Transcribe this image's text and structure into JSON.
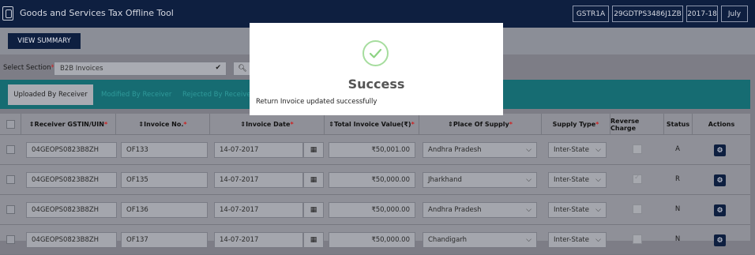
{
  "header": {
    "title": "Goods and Services Tax Offline Tool",
    "return_type": "GSTR1A",
    "gstin": "29GDTPS3486J1ZB",
    "year": "2017-18",
    "month": "July"
  },
  "toolbar": {
    "view_summary_label": "VIEW SUMMARY"
  },
  "section": {
    "label": "Select Section",
    "value": "B2B Invoices"
  },
  "tabs": [
    "Uploaded By Receiver",
    "Modified By Receiver",
    "Rejected By Receiver"
  ],
  "table": {
    "headers": {
      "receiver": "Receiver GSTIN/UIN",
      "invoice_no": "Invoice No.",
      "invoice_date": "Invoice Date",
      "total_value": "Total Invoice Value(₹)",
      "place": "Place Of Supply",
      "supply_type": "Supply Type",
      "reverse_charge": "Reverse Charge",
      "status": "Status",
      "actions": "Actions"
    },
    "rows": [
      {
        "gstin": "04GEOPS0823B8ZH",
        "invoice_no": "OF133",
        "date": "14-07-2017",
        "value": "₹50,001.00",
        "place": "Andhra Pradesh",
        "supply_type": "Inter-State",
        "reverse_checked": false,
        "status": "A"
      },
      {
        "gstin": "04GEOPS0823B8ZH",
        "invoice_no": "OF135",
        "date": "14-07-2017",
        "value": "₹50,000.00",
        "place": "Jharkhand",
        "supply_type": "Inter-State",
        "reverse_checked": true,
        "status": "R"
      },
      {
        "gstin": "04GEOPS0823B8ZH",
        "invoice_no": "OF136",
        "date": "14-07-2017",
        "value": "₹50,000.00",
        "place": "Andhra Pradesh",
        "supply_type": "Inter-State",
        "reverse_checked": false,
        "status": "N"
      },
      {
        "gstin": "04GEOPS0823B8ZH",
        "invoice_no": "OF137",
        "date": "14-07-2017",
        "value": "₹50,000.00",
        "place": "Chandigarh",
        "supply_type": "Inter-State",
        "reverse_checked": false,
        "status": "N"
      }
    ]
  },
  "modal": {
    "title": "Success",
    "message": "Return Invoice updated successfully"
  },
  "colors": {
    "header_bg": "#0e1f40",
    "tab_bar": "#166c72",
    "success_check": "#a6dd9e"
  }
}
